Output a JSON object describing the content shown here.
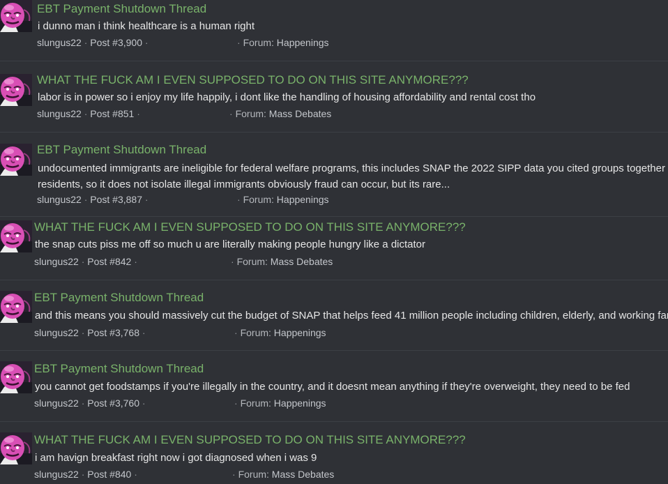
{
  "results": [
    {
      "title": "EBT Payment Shutdown Thread",
      "snippet_lines": [
        "i dunno man i think healthcare is a human right"
      ],
      "author": "slungus22",
      "post_label": "Post #3,900",
      "forum_label": "Forum:",
      "forum": "Happenings"
    },
    {
      "title": "WHAT THE FUCK AM I EVEN SUPPOSED TO DO ON THIS SITE ANYMORE???",
      "snippet_lines": [
        "labor is in power so i enjoy my life happily, i dont like the handling of housing affordability and rental cost tho"
      ],
      "author": "slungus22",
      "post_label": "Post #851",
      "forum_label": "Forum:",
      "forum": "Mass Debates"
    },
    {
      "title": "EBT Payment Shutdown Thread",
      "snippet_lines": [
        "undocumented immigrants are ineligible for federal welfare programs, this includes SNAP the 2022 SIPP data you cited groups together",
        "residents, so it does not isolate illegal immigrants obviously fraud can occur, but its rare..."
      ],
      "author": "slungus22",
      "post_label": "Post #3,887",
      "forum_label": "Forum:",
      "forum": "Happenings"
    },
    {
      "title": "WHAT THE FUCK AM I EVEN SUPPOSED TO DO ON THIS SITE ANYMORE???",
      "snippet_lines": [
        "the snap cuts piss me off so much u are literally making people hungry like a dictator"
      ],
      "author": "slungus22",
      "post_label": "Post #842",
      "forum_label": "Forum:",
      "forum": "Mass Debates"
    },
    {
      "title": "EBT Payment Shutdown Thread",
      "snippet_lines": [
        "and this means you should massively cut the budget of SNAP that helps feed 41 million people including children, elderly, and working families"
      ],
      "author": "slungus22",
      "post_label": "Post #3,768",
      "forum_label": "Forum:",
      "forum": "Happenings"
    },
    {
      "title": "EBT Payment Shutdown Thread",
      "snippet_lines": [
        "you cannot get foodstamps if you're illegally in the country, and it doesnt mean anything if they're overweight, they need to be fed"
      ],
      "author": "slungus22",
      "post_label": "Post #3,760",
      "forum_label": "Forum:",
      "forum": "Happenings"
    },
    {
      "title": "WHAT THE FUCK AM I EVEN SUPPOSED TO DO ON THIS SITE ANYMORE???",
      "snippet_lines": [
        "i am havign breakfast right now i got diagnosed when i was 9"
      ],
      "author": "slungus22",
      "post_label": "Post #840",
      "forum_label": "Forum:",
      "forum": "Mass Debates"
    }
  ],
  "separator": "·",
  "colors": {
    "background": "#2f3136",
    "title": "#79b26a",
    "snippet": "#e6e6e6",
    "meta": "#b5b8bd",
    "avatar_skin": "#d94fb5"
  },
  "icons": {
    "avatar": "bald-pink-villain-avatar-icon"
  }
}
